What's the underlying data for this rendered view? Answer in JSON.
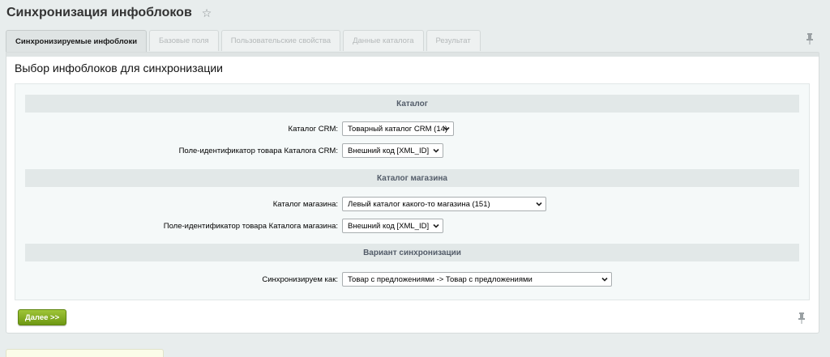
{
  "page": {
    "title": "Синхронизация инфоблоков",
    "favorite_icon": "star-icon"
  },
  "tabs": [
    {
      "label": "Синхронизируемые инфоблоки",
      "active": true
    },
    {
      "label": "Базовые поля",
      "active": false
    },
    {
      "label": "Пользовательские свойства",
      "active": false
    },
    {
      "label": "Данные каталога",
      "active": false
    },
    {
      "label": "Результат",
      "active": false
    }
  ],
  "section": {
    "title": "Выбор инфоблоков для синхронизации"
  },
  "groups": {
    "catalog": {
      "header": "Каталог",
      "crm_catalog_label": "Каталог CRM:",
      "crm_catalog_value": "Товарный каталог CRM (14)",
      "crm_id_field_label": "Поле-идентификатор товара Каталога CRM:",
      "crm_id_field_value": "Внешний код [XML_ID]"
    },
    "shop_catalog": {
      "header": "Каталог магазина",
      "shop_catalog_label": "Каталог магазина:",
      "shop_catalog_value": "Левый каталог какого-то магазина (151)",
      "shop_id_field_label": "Поле-идентификатор товара Каталога магазина:",
      "shop_id_field_value": "Внешний код [XML_ID]"
    },
    "sync_variant": {
      "header": "Вариант синхронизации",
      "sync_as_label": "Синхронизируем как:",
      "sync_as_value": "Товар с предложениями -> Товар с предложениями"
    }
  },
  "actions": {
    "next_label": "Далее >>"
  },
  "colors": {
    "accent_green": "#7aa31c",
    "group_header_bg": "#e2e8e8",
    "page_bg": "#e8eded"
  }
}
